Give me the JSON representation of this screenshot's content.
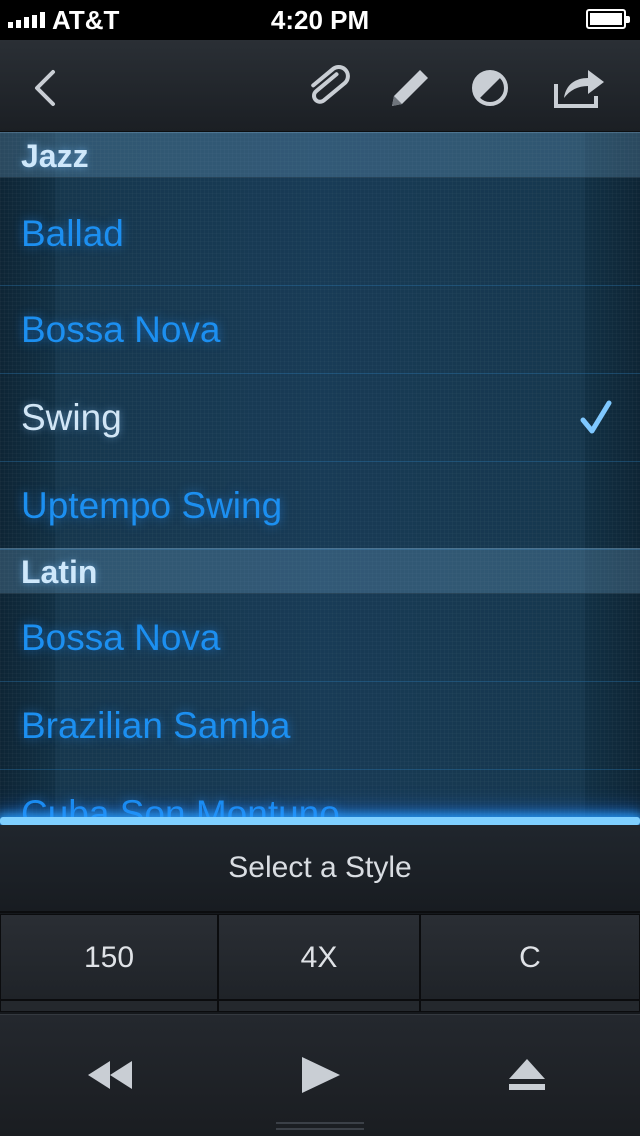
{
  "status_bar": {
    "carrier": "AT&T",
    "time": "4:20 PM"
  },
  "toolbar": {
    "icons": [
      "back-chevron-icon",
      "paperclip-icon",
      "pencil-icon",
      "circle-slash-icon",
      "share-icon"
    ]
  },
  "style_list": {
    "sections": [
      {
        "header": "Jazz",
        "items": [
          {
            "label": "Ballad",
            "selected": false
          },
          {
            "label": "Bossa Nova",
            "selected": false
          },
          {
            "label": "Swing",
            "selected": true
          },
          {
            "label": "Uptempo Swing",
            "selected": false
          }
        ]
      },
      {
        "header": "Latin",
        "items": [
          {
            "label": "Bossa Nova",
            "selected": false
          },
          {
            "label": "Brazilian Samba",
            "selected": false
          },
          {
            "label": "Cuba Son Montuno",
            "selected": false
          }
        ]
      }
    ],
    "colors": {
      "item_text": "#1c8ff0",
      "selected_text": "#d2e6f6",
      "checkmark": "#7fc8ff"
    }
  },
  "footer": {
    "title": "Select a Style",
    "tempo": "150",
    "repeats": "4X",
    "key": "C",
    "transport_icons": [
      "rewind-icon",
      "play-icon",
      "eject-icon"
    ]
  }
}
